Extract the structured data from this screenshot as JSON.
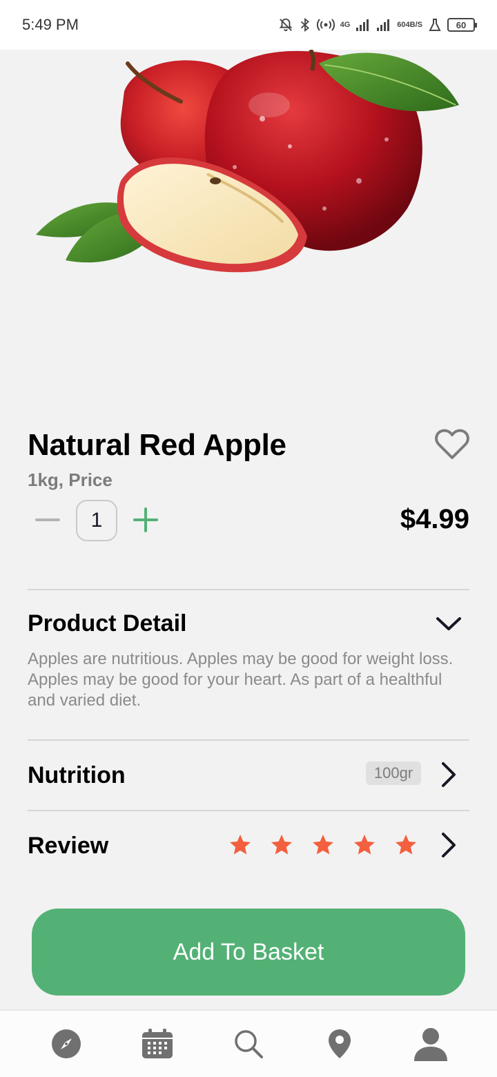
{
  "status_bar": {
    "time": "5:49 PM",
    "net_speed_value": "604",
    "net_speed_unit": "B/S",
    "network_type": "4G",
    "battery": "60"
  },
  "product": {
    "title": "Natural Red Apple",
    "subtitle": "1kg, Price",
    "quantity": "1",
    "price": "$4.99",
    "favorited": false
  },
  "detail": {
    "title": "Product Detail",
    "text": "Apples are nutritious. Apples may be good for weight loss. Apples may be good for your heart. As part of a healthful and varied diet."
  },
  "nutrition": {
    "label": "Nutrition",
    "badge": "100gr"
  },
  "review": {
    "label": "Review",
    "rating": 5,
    "max_rating": 5
  },
  "actions": {
    "add_to_basket": "Add To Basket"
  },
  "bottom_nav": {
    "items": [
      {
        "icon": "compass-icon"
      },
      {
        "icon": "calendar-icon"
      },
      {
        "icon": "search-icon"
      },
      {
        "icon": "location-pin-icon"
      },
      {
        "icon": "user-icon"
      }
    ]
  },
  "colors": {
    "accent": "#53b175",
    "star": "#f3603f",
    "text_dark": "#181725",
    "text_muted": "#7c7c7c",
    "background": "#f2f2f2"
  }
}
